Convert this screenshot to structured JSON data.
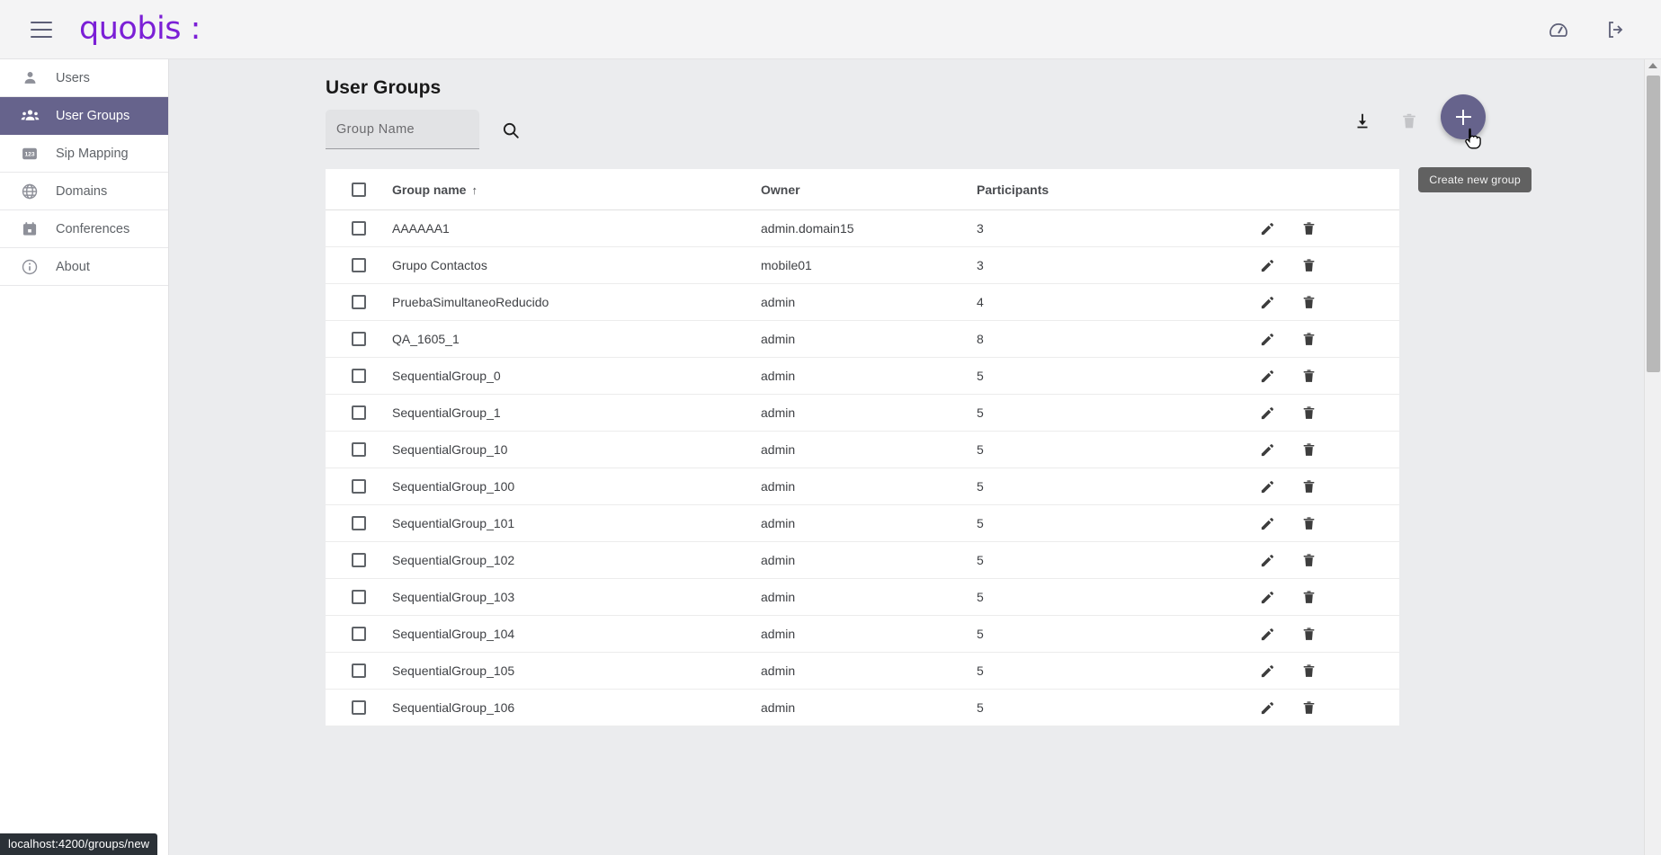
{
  "topbar": {
    "brand": "quobis :",
    "menu_icon": "hamburger-icon",
    "dashboard_icon": "speedometer-icon",
    "logout_icon": "logout-icon"
  },
  "sidebar": {
    "items": [
      {
        "label": "Users",
        "icon": "person-icon",
        "active": false
      },
      {
        "label": "User Groups",
        "icon": "people-icon",
        "active": true
      },
      {
        "label": "Sip Mapping",
        "icon": "numbers-icon",
        "active": false
      },
      {
        "label": "Domains",
        "icon": "globe-icon",
        "active": false
      },
      {
        "label": "Conferences",
        "icon": "calendar-icon",
        "active": false
      },
      {
        "label": "About",
        "icon": "info-icon",
        "active": false
      }
    ]
  },
  "main": {
    "page_title": "User Groups",
    "search": {
      "placeholder": "Group Name",
      "value": "",
      "search_icon": "search-icon"
    },
    "toolbar": {
      "download_label": "Download",
      "download_icon": "download-icon",
      "delete_label": "Delete",
      "delete_icon": "trash-icon",
      "create_label": "Create new group",
      "create_icon": "plus-icon"
    },
    "tooltip": "Create new group",
    "table": {
      "columns": [
        "Group name",
        "Owner",
        "Participants"
      ],
      "sort_column": "Group name",
      "sort_direction": "ascending",
      "sort_arrow": "↑",
      "row_actions": [
        {
          "label": "Edit",
          "icon": "pencil-icon"
        },
        {
          "label": "Delete",
          "icon": "trash-icon"
        }
      ],
      "rows": [
        {
          "name": "AAAAAA1",
          "owner": "admin.domain15",
          "participants": "3"
        },
        {
          "name": "Grupo Contactos",
          "owner": "mobile01",
          "participants": "3"
        },
        {
          "name": "PruebaSimultaneoReducido",
          "owner": "admin",
          "participants": "4"
        },
        {
          "name": "QA_1605_1",
          "owner": "admin",
          "participants": "8"
        },
        {
          "name": "SequentialGroup_0",
          "owner": "admin",
          "participants": "5"
        },
        {
          "name": "SequentialGroup_1",
          "owner": "admin",
          "participants": "5"
        },
        {
          "name": "SequentialGroup_10",
          "owner": "admin",
          "participants": "5"
        },
        {
          "name": "SequentialGroup_100",
          "owner": "admin",
          "participants": "5"
        },
        {
          "name": "SequentialGroup_101",
          "owner": "admin",
          "participants": "5"
        },
        {
          "name": "SequentialGroup_102",
          "owner": "admin",
          "participants": "5"
        },
        {
          "name": "SequentialGroup_103",
          "owner": "admin",
          "participants": "5"
        },
        {
          "name": "SequentialGroup_104",
          "owner": "admin",
          "participants": "5"
        },
        {
          "name": "SequentialGroup_105",
          "owner": "admin",
          "participants": "5"
        },
        {
          "name": "SequentialGroup_106",
          "owner": "admin",
          "participants": "5"
        }
      ]
    }
  },
  "statusbar": {
    "url": "localhost:4200/groups/new"
  },
  "colors": {
    "brand_purple": "#7b1fd6",
    "accent_purple": "#66638c",
    "page_background": "#ebecee",
    "surface": "#ffffff",
    "topbar": "#f4f4f5",
    "tooltip_background": "#616161",
    "statusbar_background": "#2b3137"
  }
}
